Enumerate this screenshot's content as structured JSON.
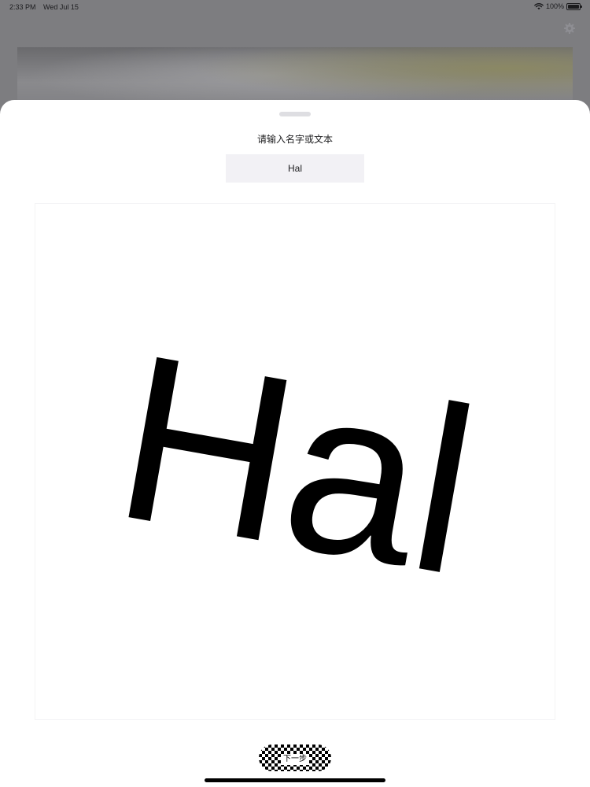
{
  "status_bar": {
    "time": "2:33 PM",
    "date": "Wed Jul 15",
    "battery": "100%"
  },
  "icons": {
    "wifi": "wifi-icon",
    "battery": "battery-icon",
    "settings": "gear-icon"
  },
  "sheet": {
    "prompt": "请输入名字或文本",
    "input_value": "Hal",
    "preview_text": "Hal",
    "next_button_label": "下一步"
  },
  "colors": {
    "dimmed_background": "#7d7d80",
    "sheet_background": "#ffffff",
    "input_background": "#f2f1f5",
    "text": "#1c1c1e"
  }
}
